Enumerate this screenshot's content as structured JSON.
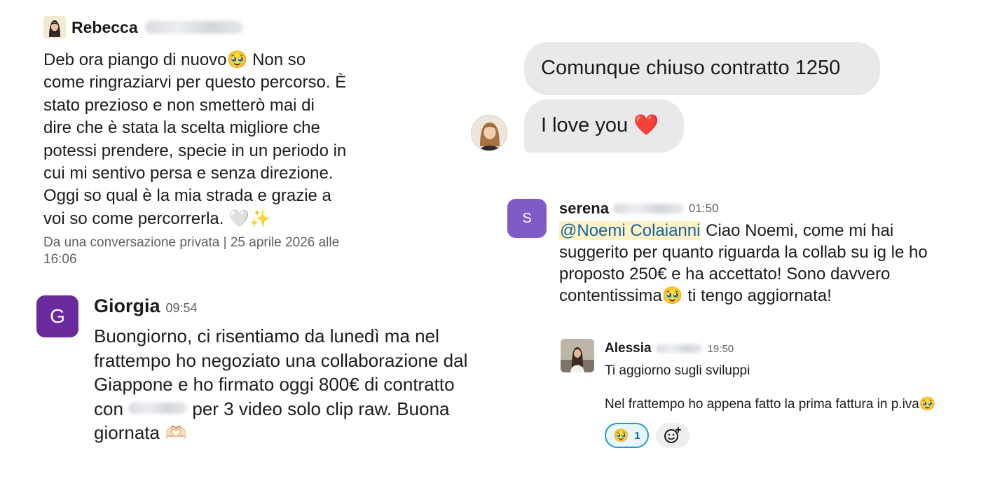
{
  "rebecca": {
    "name": "Rebecca",
    "message": "Deb ora piango di nuovo🥹 Non so\ncome ringraziarvi per questo percorso. È\nstato prezioso e non smetterò mai di\ndire che è stata la scelta migliore che\npotessi prendere, specie in un periodo in\ncui mi sentivo persa e senza direzione.\nOggi so qual è la mia strada e grazie a\nvoi so come percorrerla. 🤍✨",
    "meta": "Da una conversazione privata | 25 aprile 2026 alle\n16:06"
  },
  "giorgia": {
    "avatar_letter": "G",
    "name": "Giorgia",
    "time": "09:54",
    "message_part1": "Buongiorno, ci risentiamo da lunedì ma nel\nfrattempo ho negoziato una collaborazione dal\nGiappone e ho firmato oggi 800€ di contratto\ncon ",
    "message_part2": " per 3 video solo clip raw. Buona\ngiornata 🫶🏻"
  },
  "imessage": {
    "bubble1": "Comunque chiuso contratto 1250",
    "bubble2": "I love you ❤️"
  },
  "serena": {
    "avatar_letter": "S",
    "name": "serena",
    "time": "01:50",
    "mention": "@Noemi Colaianni",
    "message": " Ciao Noemi, come mi hai suggerito per quanto riguarda la collab su ig le ho proposto 250€ e ha accettato! Sono davvero contentissima🥹 ti tengo aggiornata!"
  },
  "alessia": {
    "name": "Alessia",
    "time": "19:50",
    "line1": "Ti aggiorno sugli sviluppi",
    "line2": "Nel frattempo ho appena fatto la prima fattura in p.iva🥹",
    "reaction_emoji": "🥹",
    "reaction_count": "1"
  },
  "colors": {
    "giorgia_avatar": "#6a2a9c",
    "serena_avatar": "#7f5bc8",
    "bubble_bg": "#e9e9eb",
    "mention_bg": "#fdf2c6",
    "mention_text": "#1264a3",
    "reaction_border": "#1d9bd1"
  },
  "icons": {
    "add_reaction": "add-reaction-icon",
    "avatar_rebecca": "avatar-photo",
    "avatar_imessage": "avatar-photo",
    "avatar_alessia": "avatar-photo"
  }
}
